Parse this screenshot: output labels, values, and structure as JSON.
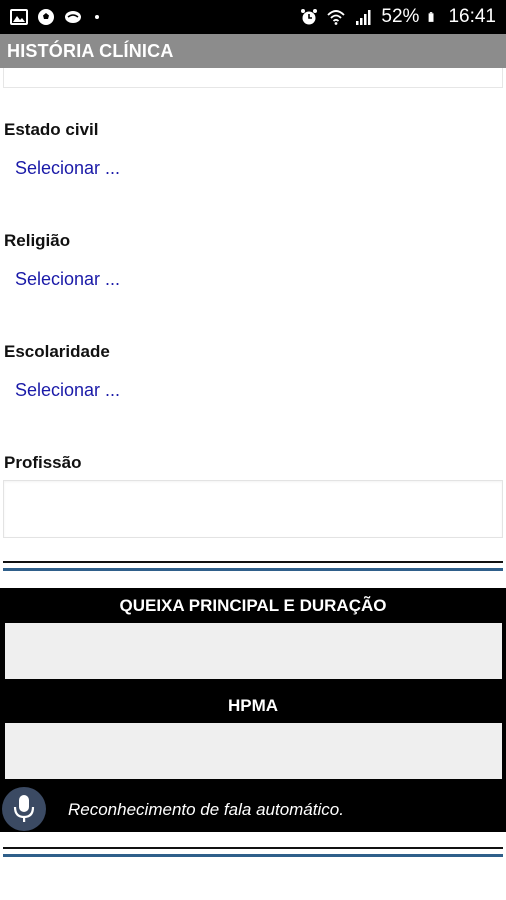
{
  "status_bar": {
    "battery": "52%",
    "time": "16:41",
    "icons": [
      "image-icon",
      "soccer-ball-icon",
      "cloud-icon",
      "alarm-icon",
      "wifi-icon",
      "signal-icon",
      "battery-icon"
    ]
  },
  "header": {
    "title": "HISTÓRIA CLÍNICA"
  },
  "form": {
    "estado_civil": {
      "label": "Estado civil",
      "select_text": "Selecionar ..."
    },
    "religiao": {
      "label": "Religião",
      "select_text": "Selecionar ..."
    },
    "escolaridade": {
      "label": "Escolaridade",
      "select_text": "Selecionar ..."
    },
    "profissao": {
      "label": "Profissão",
      "value": ""
    }
  },
  "panel": {
    "queixa_title": "QUEIXA PRINCIPAL E DURAÇÃO",
    "queixa_value": "",
    "hpma_title": "HPMA",
    "hpma_value": "",
    "speech_label": "Reconhecimento de fala automático."
  },
  "colors": {
    "header_bg": "#8c8c8c",
    "select_text": "#1a1aa8",
    "divider_blue": "#2f5f8a",
    "mic_bg": "#3b4a63"
  }
}
